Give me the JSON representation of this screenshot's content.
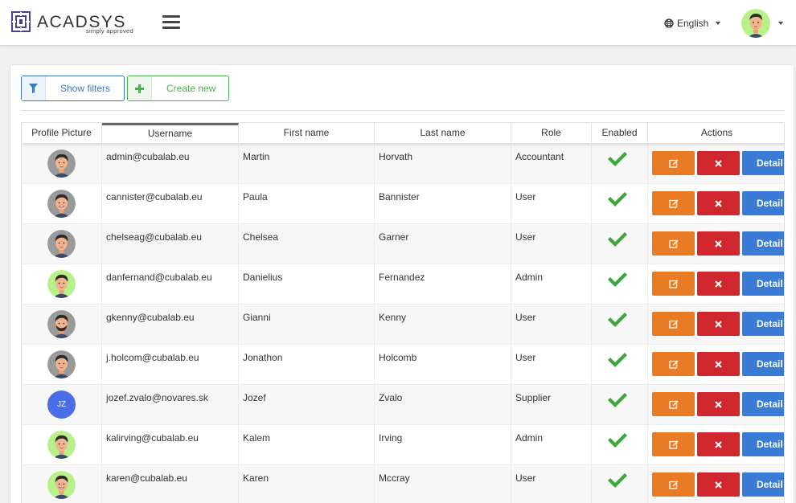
{
  "app": {
    "logo_text": "ACADSYS",
    "logo_tagline": "simply approved",
    "language": "English"
  },
  "toolbar": {
    "show_filters": "Show filters",
    "create_new": "Create new"
  },
  "table": {
    "columns": [
      "Profile Picture",
      "Username",
      "First name",
      "Last name",
      "Role",
      "Enabled",
      "Actions"
    ],
    "detail_label": "Detail",
    "rows": [
      {
        "avatar": "face-dark-hair-gray",
        "initials": "",
        "username": "admin@cubalab.eu",
        "first_name": "Martin",
        "last_name": "Horvath",
        "role": "Accountant",
        "enabled": true
      },
      {
        "avatar": "face-smile-gray",
        "initials": "",
        "username": "cannister@cubalab.eu",
        "first_name": "Paula",
        "last_name": "Bannister",
        "role": "User",
        "enabled": true
      },
      {
        "avatar": "face-dark-hair-gray",
        "initials": "",
        "username": "chelseag@cubalab.eu",
        "first_name": "Chelsea",
        "last_name": "Garner",
        "role": "User",
        "enabled": true
      },
      {
        "avatar": "face-green",
        "initials": "",
        "username": "danfernand@cubalab.eu",
        "first_name": "Danielius",
        "last_name": "Fernandez",
        "role": "Admin",
        "enabled": true
      },
      {
        "avatar": "face-beard-gray",
        "initials": "",
        "username": "gkenny@cubalab.eu",
        "first_name": "Gianni",
        "last_name": "Kenny",
        "role": "User",
        "enabled": true
      },
      {
        "avatar": "face-dark-hair-gray",
        "initials": "",
        "username": "j.holcom@cubalab.eu",
        "first_name": "Jonathon",
        "last_name": "Holcomb",
        "role": "User",
        "enabled": true
      },
      {
        "avatar": "initials",
        "initials": "JZ",
        "username": "jozef.zvalo@novares.sk",
        "first_name": "Jozef",
        "last_name": "Zvalo",
        "role": "Supplier",
        "enabled": true
      },
      {
        "avatar": "face-green",
        "initials": "",
        "username": "kalirving@cubalab.eu",
        "first_name": "Kalem",
        "last_name": "Irving",
        "role": "Admin",
        "enabled": true
      },
      {
        "avatar": "face-smile-green",
        "initials": "",
        "username": "karen@cubalab.eu",
        "first_name": "Karen",
        "last_name": "Mccray",
        "role": "User",
        "enabled": true
      }
    ]
  },
  "colors": {
    "filters": "#3a78c2",
    "create": "#4fae4e",
    "edit": "#e97b25",
    "delete": "#d0262e",
    "detail": "#3a7cd5",
    "check": "#3ea63c",
    "avatar_initials_bg": "#4b6de8"
  }
}
